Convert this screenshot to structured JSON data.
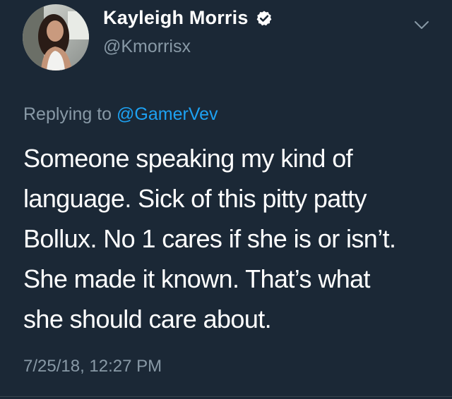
{
  "author": {
    "display_name": "Kayleigh Morris",
    "handle": "@Kmorrisx",
    "verified": true,
    "avatar_icon": "profile-photo"
  },
  "reply": {
    "prefix": "Replying to",
    "mention": "@GamerVev"
  },
  "tweet": {
    "lines": [
      "Someone speaking my kind of",
      "language. Sick of this pitty patty",
      "Bollux. No 1 cares if she is or isn’t.",
      "She made it known. That’s what",
      "she should care about."
    ],
    "timestamp": "7/25/18, 12:27 PM"
  },
  "icons": {
    "verified": "verified-badge-icon",
    "menu": "chevron-down-icon"
  },
  "colors": {
    "background": "#1b2836",
    "primary_text": "#ffffff",
    "secondary_text": "#8899a6",
    "link": "#1da1f2"
  }
}
